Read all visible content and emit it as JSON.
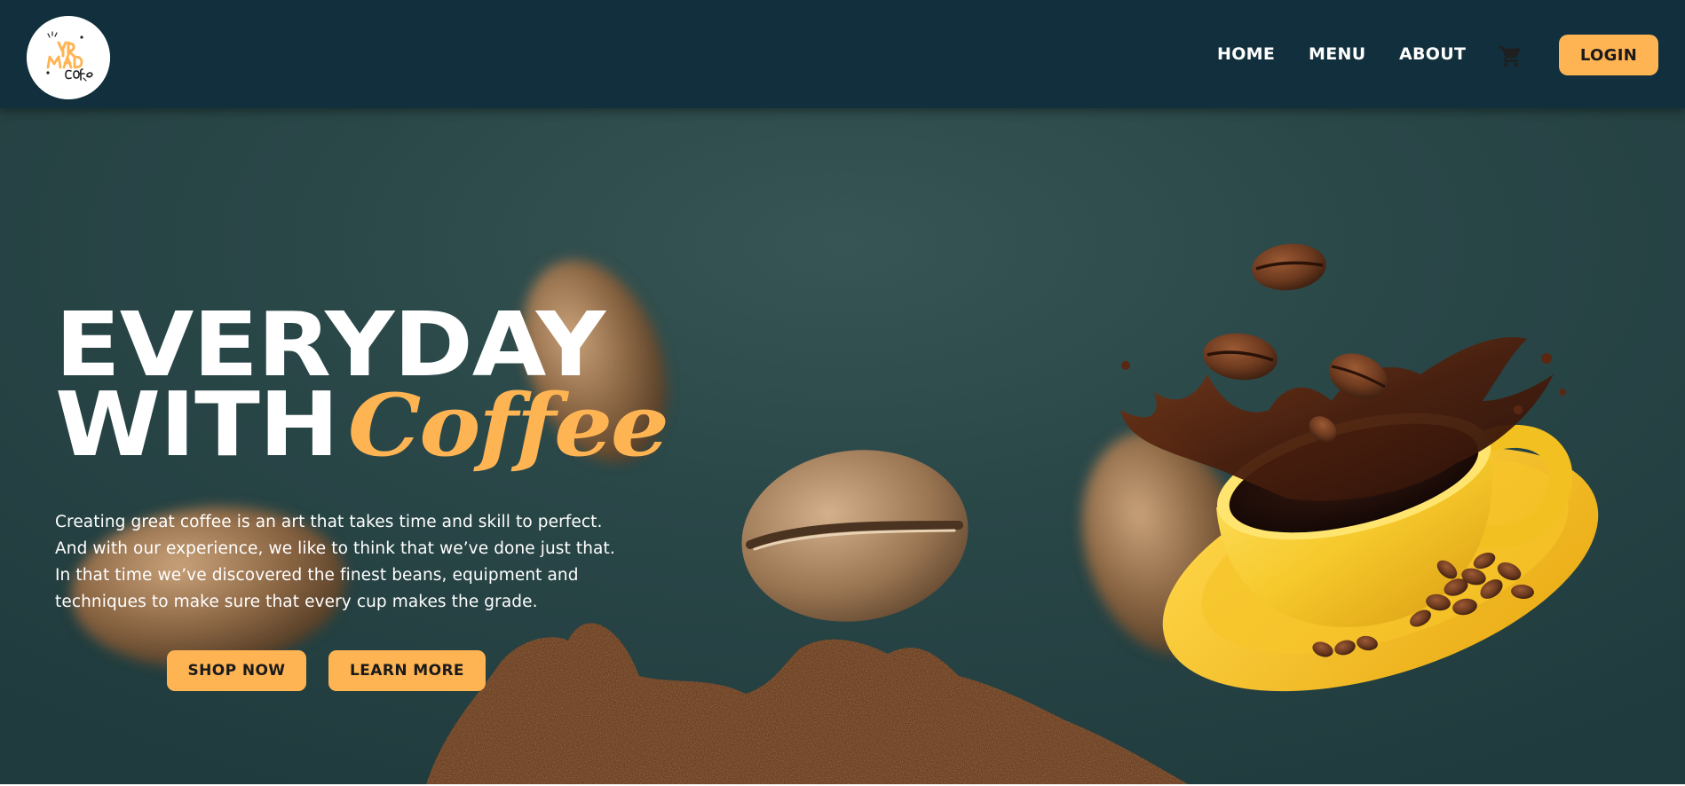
{
  "header": {
    "logo_alt": "YR MATCHA Coffee logo",
    "nav": {
      "home": "HOME",
      "menu": "MENU",
      "about": "ABOUT"
    },
    "cart_icon": "cart-icon",
    "login_label": "LOGIN"
  },
  "hero": {
    "headline_line1": "EVERYDAY",
    "headline_line2_word": "WITH",
    "headline_accent": "Coffee",
    "description": "Creating great coffee is an art that takes time and skill to perfect. And with our experience, we like to think that we’ve done just that. In that time we’ve discovered the finest beans, equipment and techniques to make sure that every cup makes the grade.",
    "buttons": {
      "shop_now": "SHOP NOW",
      "learn_more": "LEARN MORE"
    }
  },
  "colors": {
    "header_bg": "#112f3c",
    "hero_bg": "#2a4748",
    "accent": "#ffb454",
    "text_light": "#ffffff"
  }
}
